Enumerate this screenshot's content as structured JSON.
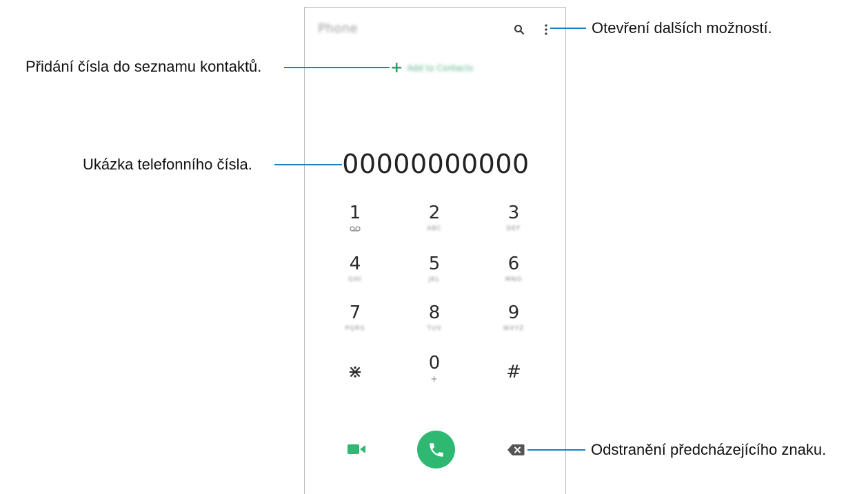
{
  "app": {
    "title": "Phone",
    "add_to_contacts_label": "Add to Contacts",
    "add_to_contacts_icon": "plus-icon"
  },
  "header": {
    "search_icon": "search-icon",
    "more_icon": "more-options-icon"
  },
  "display": {
    "number": "00000000000"
  },
  "keypad": [
    {
      "digit": "1",
      "sub": "",
      "sub_icon": "voicemail-icon"
    },
    {
      "digit": "2",
      "sub": "ABC"
    },
    {
      "digit": "3",
      "sub": "DEF"
    },
    {
      "digit": "4",
      "sub": "GHI"
    },
    {
      "digit": "5",
      "sub": "JKL"
    },
    {
      "digit": "6",
      "sub": "MNO"
    },
    {
      "digit": "7",
      "sub": "PQRS"
    },
    {
      "digit": "8",
      "sub": "TUV"
    },
    {
      "digit": "9",
      "sub": "WXYZ"
    },
    {
      "digit": "⋇",
      "sub": ""
    },
    {
      "digit": "0",
      "sub": "+"
    },
    {
      "digit": "#",
      "sub": ""
    }
  ],
  "actions": {
    "video_call_icon": "video-camera-icon",
    "call_icon": "phone-handset-icon",
    "backspace_icon": "backspace-icon"
  },
  "callouts": {
    "more_options": "Otevření dalších možností.",
    "add_to_contacts": "Přidání čísla do seznamu kontaktů.",
    "number_preview": "Ukázka telefonního čísla.",
    "delete_previous": "Odstranění předcházejícího znaku."
  },
  "colors": {
    "accent_green": "#2eb872",
    "leader_blue": "#1a7fc0"
  }
}
